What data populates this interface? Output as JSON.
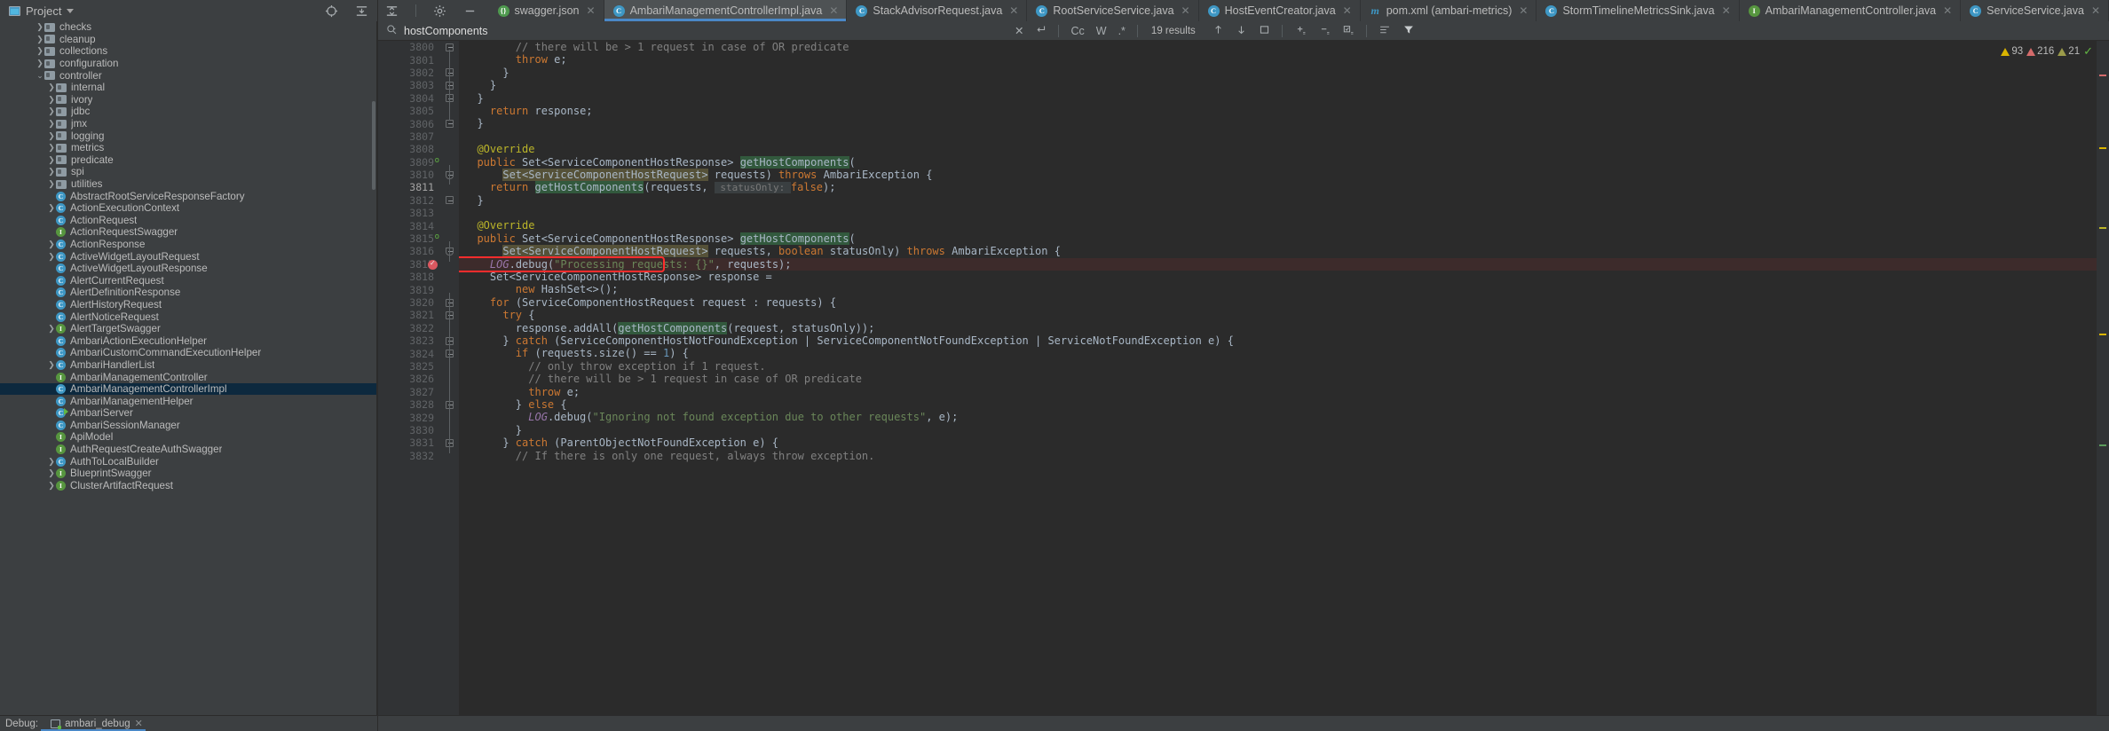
{
  "project": {
    "label": "Project",
    "icon": "project-icon",
    "dropdown_icon": "chevron-down-icon"
  },
  "toolwindow_icons": [
    {
      "name": "locate-icon",
      "glyph": "target"
    },
    {
      "name": "expand-all-icon",
      "glyph": "expand"
    },
    {
      "name": "collapse-all-icon",
      "glyph": "collapse"
    },
    {
      "name": "settings-gear-icon",
      "glyph": "gear"
    },
    {
      "name": "hide-icon",
      "glyph": "minus"
    }
  ],
  "tabs": [
    {
      "label": "swagger.json",
      "icon": "json",
      "active": false
    },
    {
      "label": "AmbariManagementControllerImpl.java",
      "icon": "class",
      "active": true
    },
    {
      "label": "StackAdvisorRequest.java",
      "icon": "class",
      "active": false
    },
    {
      "label": "RootServiceService.java",
      "icon": "class",
      "active": false
    },
    {
      "label": "HostEventCreator.java",
      "icon": "class",
      "active": false
    },
    {
      "label": "pom.xml (ambari-metrics)",
      "icon": "maven",
      "active": false
    },
    {
      "label": "StormTimelineMetricsSink.java",
      "icon": "class",
      "active": false
    },
    {
      "label": "AmbariManagementController.java",
      "icon": "interface",
      "active": false
    },
    {
      "label": "ServiceService.java",
      "icon": "class",
      "active": false
    }
  ],
  "find": {
    "search_icon": "search-icon",
    "query": "hostComponents",
    "placeholder": "Search",
    "clear_icon": "close-icon",
    "history_icon": "return-icon",
    "match_case_label": "Cc",
    "words_label": "W",
    "regex_label": ".*",
    "results": "19 results",
    "prev_icon": "arrow-up-icon",
    "next_icon": "arrow-down-icon",
    "select_all_icon": "select-all-icon",
    "add_icon": "add-occurrence-icon",
    "remove_icon": "remove-occurrence-icon",
    "select_occurrences_icon": "select-occurrences-icon",
    "in_selection_icon": "in-selection-icon",
    "filter_icon": "filter-icon"
  },
  "inspections": {
    "warnings": "93",
    "weak_warnings": "216",
    "errors": "21",
    "status_icon": "checkmark-icon"
  },
  "sidebar": {
    "scrollbar": "vertical-scrollbar",
    "items": [
      {
        "label": "checks",
        "type": "folder",
        "depth": 2,
        "arrow": "right",
        "partial": true
      },
      {
        "label": "cleanup",
        "type": "folder",
        "depth": 2,
        "arrow": "right"
      },
      {
        "label": "collections",
        "type": "folder",
        "depth": 2,
        "arrow": "right"
      },
      {
        "label": "configuration",
        "type": "folder",
        "depth": 2,
        "arrow": "right"
      },
      {
        "label": "controller",
        "type": "folder",
        "depth": 2,
        "arrow": "down"
      },
      {
        "label": "internal",
        "type": "folder",
        "depth": 3,
        "arrow": "right"
      },
      {
        "label": "ivory",
        "type": "folder",
        "depth": 3,
        "arrow": "right"
      },
      {
        "label": "jdbc",
        "type": "folder",
        "depth": 3,
        "arrow": "right"
      },
      {
        "label": "jmx",
        "type": "folder",
        "depth": 3,
        "arrow": "right"
      },
      {
        "label": "logging",
        "type": "folder",
        "depth": 3,
        "arrow": "right"
      },
      {
        "label": "metrics",
        "type": "folder",
        "depth": 3,
        "arrow": "right"
      },
      {
        "label": "predicate",
        "type": "folder",
        "depth": 3,
        "arrow": "right"
      },
      {
        "label": "spi",
        "type": "folder",
        "depth": 3,
        "arrow": "right"
      },
      {
        "label": "utilities",
        "type": "folder",
        "depth": 3,
        "arrow": "right"
      },
      {
        "label": "AbstractRootServiceResponseFactory",
        "type": "class",
        "depth": 3,
        "arrow": "none"
      },
      {
        "label": "ActionExecutionContext",
        "type": "class",
        "depth": 3,
        "arrow": "right"
      },
      {
        "label": "ActionRequest",
        "type": "class",
        "depth": 3,
        "arrow": "none"
      },
      {
        "label": "ActionRequestSwagger",
        "type": "interface",
        "depth": 3,
        "arrow": "none"
      },
      {
        "label": "ActionResponse",
        "type": "class",
        "depth": 3,
        "arrow": "right"
      },
      {
        "label": "ActiveWidgetLayoutRequest",
        "type": "class",
        "depth": 3,
        "arrow": "right"
      },
      {
        "label": "ActiveWidgetLayoutResponse",
        "type": "class",
        "depth": 3,
        "arrow": "none"
      },
      {
        "label": "AlertCurrentRequest",
        "type": "class",
        "depth": 3,
        "arrow": "none"
      },
      {
        "label": "AlertDefinitionResponse",
        "type": "class",
        "depth": 3,
        "arrow": "none"
      },
      {
        "label": "AlertHistoryRequest",
        "type": "class",
        "depth": 3,
        "arrow": "none"
      },
      {
        "label": "AlertNoticeRequest",
        "type": "class",
        "depth": 3,
        "arrow": "none"
      },
      {
        "label": "AlertTargetSwagger",
        "type": "interface",
        "depth": 3,
        "arrow": "right"
      },
      {
        "label": "AmbariActionExecutionHelper",
        "type": "class",
        "depth": 3,
        "arrow": "none"
      },
      {
        "label": "AmbariCustomCommandExecutionHelper",
        "type": "class",
        "depth": 3,
        "arrow": "none"
      },
      {
        "label": "AmbariHandlerList",
        "type": "class",
        "depth": 3,
        "arrow": "right"
      },
      {
        "label": "AmbariManagementController",
        "type": "interface",
        "depth": 3,
        "arrow": "none"
      },
      {
        "label": "AmbariManagementControllerImpl",
        "type": "class",
        "depth": 3,
        "arrow": "none",
        "selected": true
      },
      {
        "label": "AmbariManagementHelper",
        "type": "class",
        "depth": 3,
        "arrow": "none"
      },
      {
        "label": "AmbariServer",
        "type": "class-runnable",
        "depth": 3,
        "arrow": "none"
      },
      {
        "label": "AmbariSessionManager",
        "type": "class",
        "depth": 3,
        "arrow": "none"
      },
      {
        "label": "ApiModel",
        "type": "interface",
        "depth": 3,
        "arrow": "none"
      },
      {
        "label": "AuthRequestCreateAuthSwagger",
        "type": "interface",
        "depth": 3,
        "arrow": "none"
      },
      {
        "label": "AuthToLocalBuilder",
        "type": "class",
        "depth": 3,
        "arrow": "right"
      },
      {
        "label": "BlueprintSwagger",
        "type": "interface",
        "depth": 3,
        "arrow": "right"
      },
      {
        "label": "ClusterArtifactRequest",
        "type": "interface",
        "depth": 3,
        "arrow": "right",
        "partial": true
      }
    ]
  },
  "editor": {
    "first_line": 3800,
    "current_line": 3811,
    "breakpoint_line": 3817,
    "lines": [
      {
        "n": 3800,
        "fold": "collapse",
        "html": "        <span class='cmt'>// there will be &gt; 1 request in case of OR predicate</span>"
      },
      {
        "n": 3801,
        "html": "        <span class='kw'>throw</span> e;"
      },
      {
        "n": 3802,
        "fold": "collapse",
        "html": "      }"
      },
      {
        "n": 3803,
        "fold": "collapse",
        "html": "    }"
      },
      {
        "n": 3804,
        "fold": "collapse",
        "html": "  }"
      },
      {
        "n": 3805,
        "html": "    <span class='kw'>return</span> response;"
      },
      {
        "n": 3806,
        "fold": "collapse",
        "html": "  }"
      },
      {
        "n": 3807,
        "html": ""
      },
      {
        "n": 3808,
        "html": "  <span class='ann'>@Override</span>"
      },
      {
        "n": 3809,
        "override": true,
        "html": "  <span class='kw'>public</span> Set&lt;ServiceComponentHostResponse&gt; <span class='hl-g'>getHostComponents</span>("
      },
      {
        "n": 3810,
        "fold": "end",
        "html": "      <span class='hl-t'>Set&lt;ServiceComponentHostRequest&gt;</span> requests) <span class='kw'>throws</span> AmbariException {"
      },
      {
        "n": 3811,
        "current": true,
        "html": "    <span class='kw'>return</span> <span class='hl-g'>getHostComponents</span>(requests, <span class='hint'> statusOnly: </span><span class='kw'>false</span>);"
      },
      {
        "n": 3812,
        "fold": "collapse",
        "html": "  }"
      },
      {
        "n": 3813,
        "html": ""
      },
      {
        "n": 3814,
        "html": "  <span class='ann'>@Override</span>"
      },
      {
        "n": 3815,
        "override": true,
        "html": "  <span class='kw'>public</span> Set&lt;ServiceComponentHostResponse&gt; <span class='hl-g'>getHostComponents</span>("
      },
      {
        "n": 3816,
        "fold": "end",
        "html": "      <span class='hl-t'>Set&lt;ServiceComponentHostRequest&gt;</span> requests, <span class='kw'>boolean</span> statusOnly) <span class='kw'>throws</span> AmbariException {"
      },
      {
        "n": 3817,
        "breakpoint": true,
        "error": true,
        "html": "    <span class='fld'>LOG</span>.debug(<span class='str'>\"Processing requests: {}\"</span>, requests);"
      },
      {
        "n": 3818,
        "html": "    Set&lt;ServiceComponentHostResponse&gt; response ="
      },
      {
        "n": 3819,
        "html": "        <span class='kw'>new</span> HashSet&lt;&gt;();"
      },
      {
        "n": 3820,
        "fold": "collapse",
        "html": "    <span class='kw'>for</span> (ServiceComponentHostRequest request : requests) {"
      },
      {
        "n": 3821,
        "fold": "collapse",
        "html": "      <span class='kw'>try</span> {"
      },
      {
        "n": 3822,
        "html": "        response.addAll(<span class='hl-g'>getHostComponents</span>(request, statusOnly));"
      },
      {
        "n": 3823,
        "fold": "collapse",
        "html": "      } <span class='kw'>catch</span> (ServiceComponentHostNotFoundException | ServiceComponentNotFoundException | ServiceNotFoundException e) {"
      },
      {
        "n": 3824,
        "fold": "collapse",
        "html": "        <span class='kw'>if</span> (requests.size() == <span class='num'>1</span>) {"
      },
      {
        "n": 3825,
        "html": "          <span class='cmt'>// only throw exception if 1 request.</span>"
      },
      {
        "n": 3826,
        "html": "          <span class='cmt'>// there will be &gt; 1 request in case of OR predicate</span>"
      },
      {
        "n": 3827,
        "html": "          <span class='kw'>throw</span> e;"
      },
      {
        "n": 3828,
        "fold": "collapse",
        "html": "        } <span class='kw'>else</span> {"
      },
      {
        "n": 3829,
        "html": "          <span class='fld'>LOG</span>.debug(<span class='str'>\"Ignoring not found exception due to other requests\"</span>, e);"
      },
      {
        "n": 3830,
        "html": "        }"
      },
      {
        "n": 3831,
        "fold": "collapse",
        "html": "      } <span class='kw'>catch</span> (ParentObjectNotFoundException e) {"
      },
      {
        "n": 3832,
        "html": "        <span class='cmt'>// If there is only one request, always throw exception.</span>"
      }
    ]
  },
  "bottom": {
    "debug_label": "Debug:",
    "config_name": "ambari_debug",
    "config_icon": "debug-config-icon",
    "close_icon": "close-icon"
  }
}
